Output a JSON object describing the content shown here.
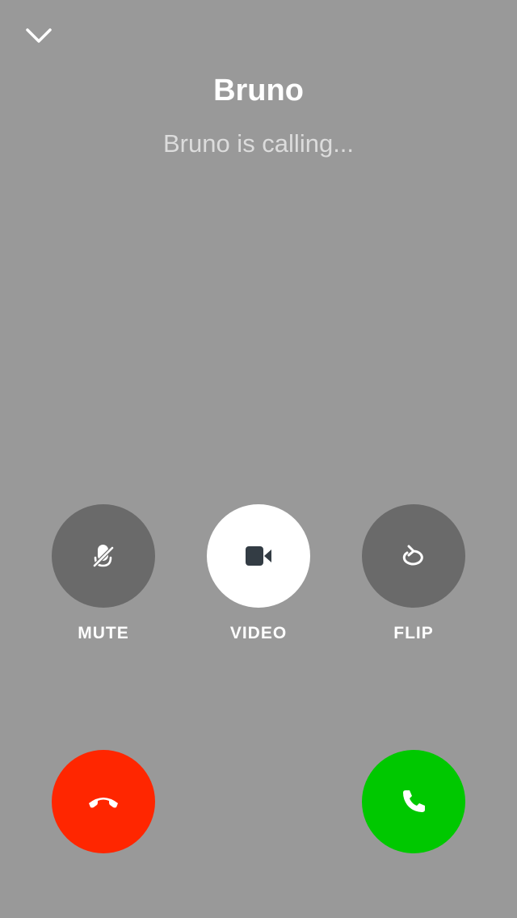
{
  "caller": {
    "name": "Bruno",
    "status": "Bruno is calling..."
  },
  "controls": {
    "mute": {
      "label": "MUTE",
      "icon": "mic-off-icon"
    },
    "video": {
      "label": "VIDEO",
      "icon": "video-camera-icon"
    },
    "flip": {
      "label": "FLIP",
      "icon": "flip-camera-icon"
    }
  },
  "actions": {
    "decline": {
      "icon": "phone-hangup-icon",
      "color": "#ff2600"
    },
    "accept": {
      "icon": "phone-icon",
      "color": "#00c800"
    }
  },
  "colors": {
    "background": "#999999",
    "control_dark": "#6a6a6a",
    "control_light": "#ffffff",
    "status_text": "#dcdcdc"
  }
}
